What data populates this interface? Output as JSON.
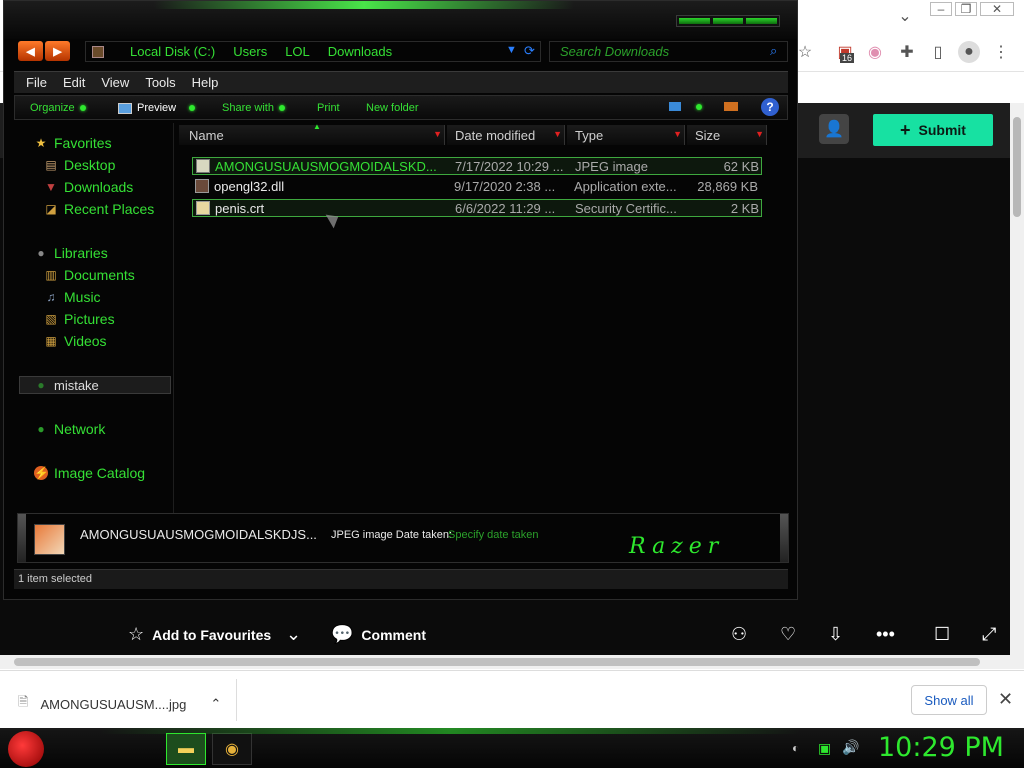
{
  "browser": {
    "submit_label": "Submit",
    "extension_badge": "16",
    "actions": {
      "favourites": "Add to Favourites",
      "comment": "Comment"
    },
    "download": {
      "filename": "AMONGUSUAUSM....jpg",
      "show_all": "Show all"
    }
  },
  "explorer": {
    "breadcrumb": [
      "Local Disk (C:)",
      "Users",
      "LOL",
      "Downloads"
    ],
    "search_placeholder": "Search Downloads",
    "menu": [
      "File",
      "Edit",
      "View",
      "Tools",
      "Help"
    ],
    "commands": {
      "organize": "Organize",
      "preview": "Preview",
      "share_with": "Share with",
      "print": "Print",
      "new_folder": "New folder"
    },
    "nav": {
      "favorites": "Favorites",
      "desktop": "Desktop",
      "downloads": "Downloads",
      "recent_places": "Recent Places",
      "libraries": "Libraries",
      "documents": "Documents",
      "music": "Music",
      "pictures": "Pictures",
      "videos": "Videos",
      "mistake": "mistake",
      "network": "Network",
      "image_catalog": "Image Catalog"
    },
    "columns": {
      "name": "Name",
      "date_modified": "Date modified",
      "type": "Type",
      "size": "Size"
    },
    "files": [
      {
        "name": "AMONGUSUAUSMOGMOIDALSKD...",
        "date": "7/17/2022 10:29 ...",
        "type": "JPEG image",
        "size": "62 KB",
        "selected": true,
        "accent": "#35e035"
      },
      {
        "name": "opengl32.dll",
        "date": "9/17/2020 2:38 ...",
        "type": "Application exte...",
        "size": "28,869 KB",
        "selected": false,
        "accent": "#eaeaea"
      },
      {
        "name": "penis.crt",
        "date": "6/6/2022 11:29 ...",
        "type": "Security Certific...",
        "size": "2 KB",
        "selected": true,
        "accent": "#eaeaea"
      }
    ],
    "details": {
      "name": "AMONGUSUAUSMOGMOIDALSKDJS...",
      "type_text": "JPEG image Date taken:",
      "date_taken": "Specify date taken",
      "logo": "Razer"
    },
    "status": "1 item selected"
  },
  "taskbar": {
    "clock": "10:29 PM"
  },
  "colors": {
    "accent_green": "#2ee82e",
    "submit_green": "#17e1a2"
  }
}
